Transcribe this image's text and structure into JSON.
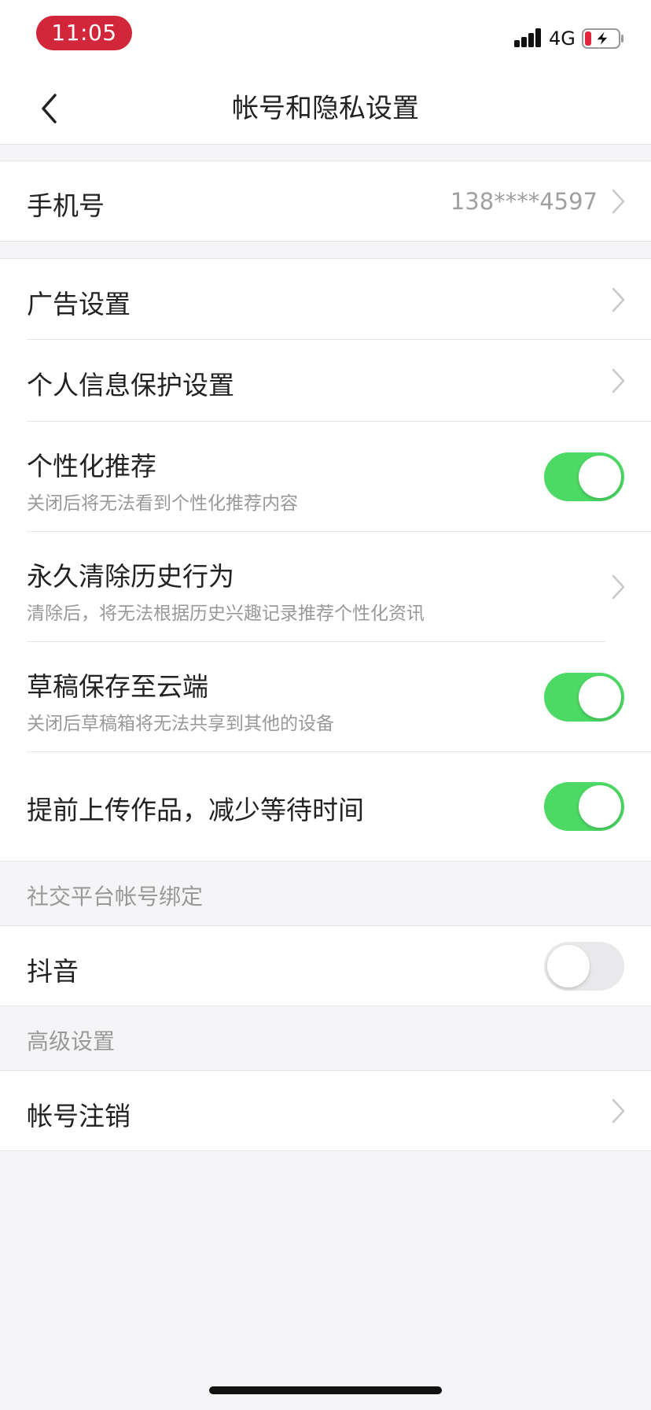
{
  "status_bar": {
    "time": "11:05",
    "network": "4G"
  },
  "nav": {
    "title": "帐号和隐私设置"
  },
  "phone": {
    "label": "手机号",
    "value": "138****4597"
  },
  "settings": {
    "ad": {
      "label": "广告设置"
    },
    "privacy": {
      "label": "个人信息保护设置"
    },
    "personalized": {
      "label": "个性化推荐",
      "desc": "关闭后将无法看到个性化推荐内容",
      "enabled": true
    },
    "clear_history": {
      "label": "永久清除历史行为",
      "desc": "清除后，将无法根据历史兴趣记录推荐个性化资讯"
    },
    "draft_cloud": {
      "label": "草稿保存至云端",
      "desc": "关闭后草稿箱将无法共享到其他的设备",
      "enabled": true
    },
    "pre_upload": {
      "label": "提前上传作品，减少等待时间",
      "enabled": true
    }
  },
  "social": {
    "header": "社交平台帐号绑定",
    "douyin": {
      "label": "抖音",
      "enabled": false
    }
  },
  "advanced": {
    "header": "高级设置",
    "delete_account": {
      "label": "帐号注销"
    }
  },
  "colors": {
    "toggle_on": "#4cd964",
    "toggle_off": "#e9e9eb",
    "time_pill": "#d2263a"
  }
}
